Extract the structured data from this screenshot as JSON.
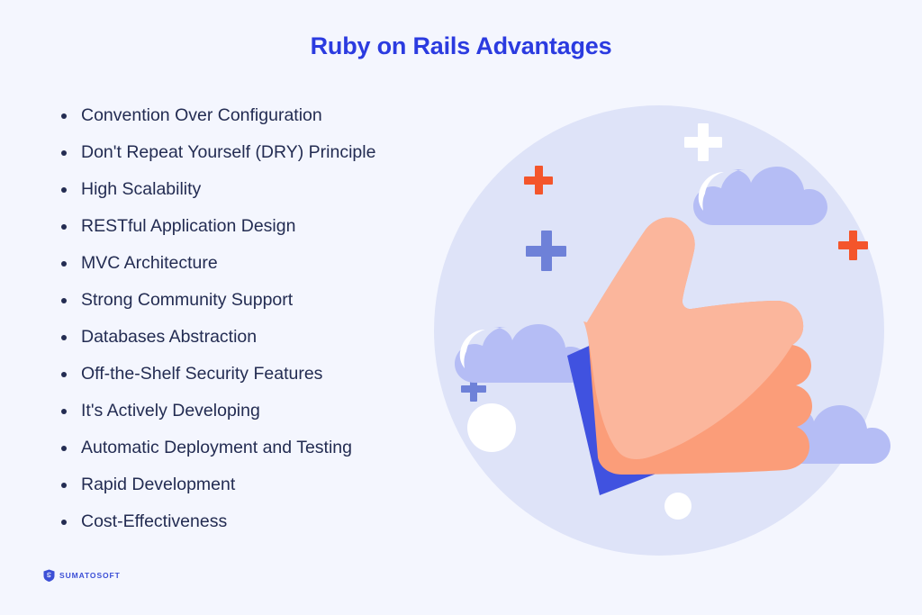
{
  "page": {
    "background_color": "#f4f6fe"
  },
  "header": {
    "title": "Ruby on Rails Advantages",
    "title_color": "#2b3be0"
  },
  "advantages": {
    "text_color": "#232c52",
    "items": [
      {
        "label": "Convention Over Configuration"
      },
      {
        "label": "Don't Repeat Yourself (DRY) Principle"
      },
      {
        "label": "High Scalability"
      },
      {
        "label": "RESTful Application Design"
      },
      {
        "label": "MVC Architecture"
      },
      {
        "label": "Strong Community Support"
      },
      {
        "label": "Databases Abstraction"
      },
      {
        "label": "Off-the-Shelf Security Features"
      },
      {
        "label": "It's Actively Developing"
      },
      {
        "label": "Automatic Deployment and Testing"
      },
      {
        "label": "Rapid Development"
      },
      {
        "label": "Cost-Effectiveness"
      }
    ]
  },
  "illustration": {
    "name": "thumbs-up-illustration",
    "circle_color": "#dee3f8",
    "hand_color": "#fbb69c",
    "hand_shadow_color": "#fb9d79",
    "cuff_color": "#4052e0",
    "cloud_color": "#b5bdf5",
    "plus_blue_color": "#6e81d8",
    "plus_orange_color": "#f4552b",
    "plus_white_color": "#ffffff",
    "dot_color": "#ffffff"
  },
  "logo": {
    "wordmark": "SUMATOSOFT",
    "color": "#3c4fd6",
    "mark_name": "shield-s-icon"
  }
}
